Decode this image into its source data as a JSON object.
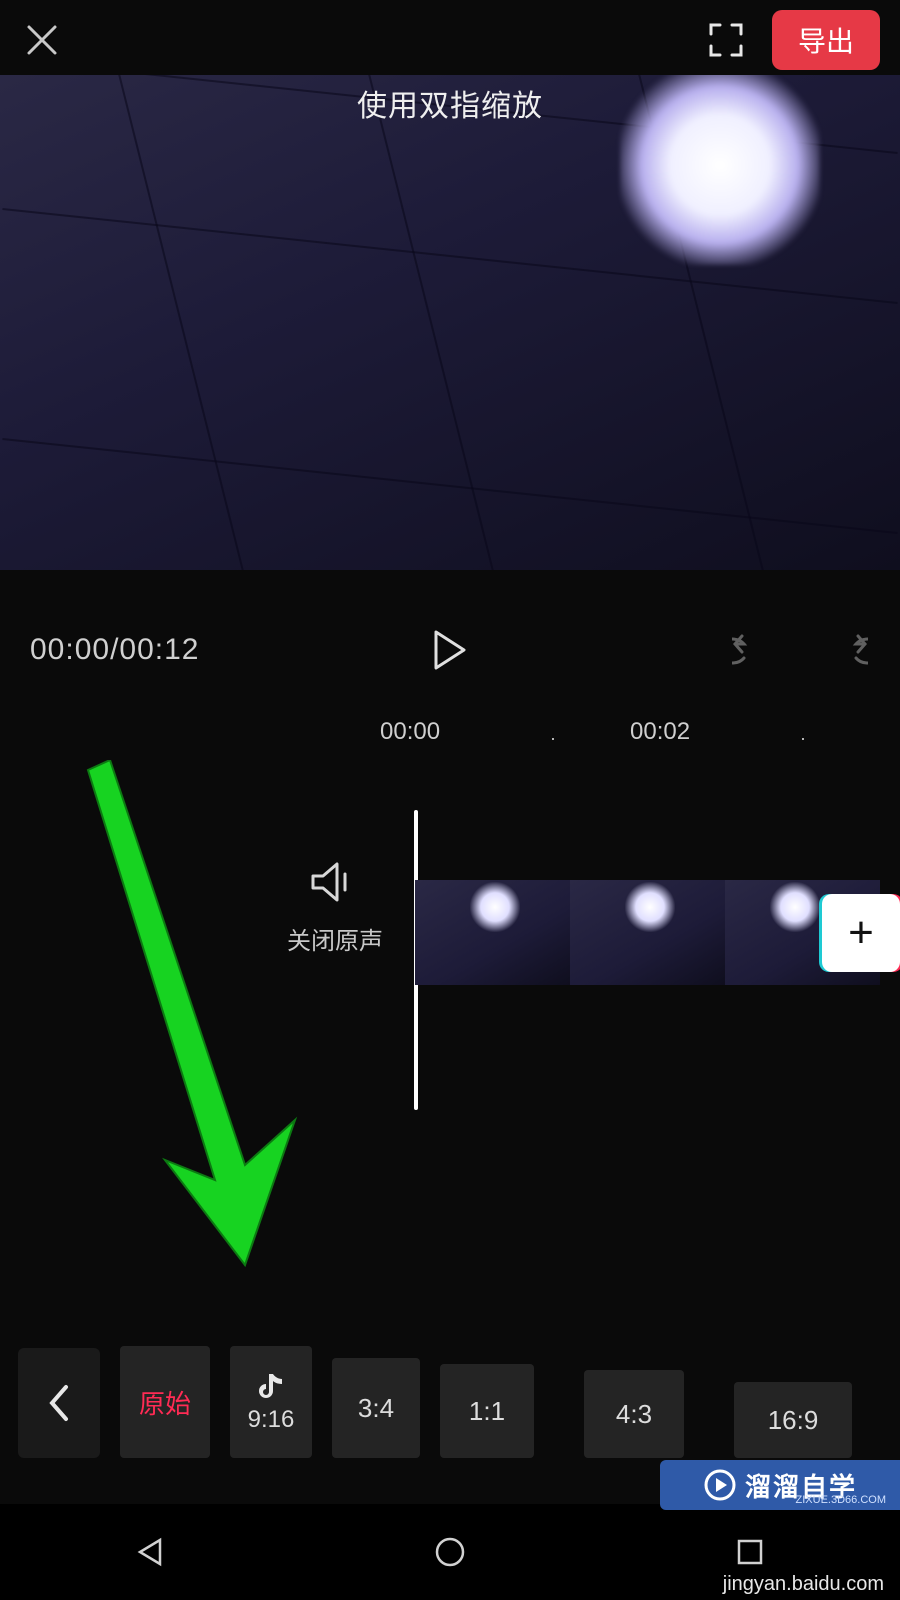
{
  "header": {
    "hint_text": "使用双指缩放",
    "export_label": "导出"
  },
  "controls": {
    "time_display": "00:00/00:12"
  },
  "ruler": {
    "tick_0": "00:00",
    "tick_2": "00:02",
    "dot": "·"
  },
  "timeline": {
    "mute_label": "关闭原声"
  },
  "ratio_bar": {
    "original": "原始",
    "r_9_16": "9:16",
    "r_3_4": "3:4",
    "r_1_1": "1:1",
    "r_4_3": "4:3",
    "r_16_9": "16:9"
  },
  "watermark": {
    "brand": "溜溜自学",
    "sub": "ZIXUE.3D66.COM",
    "credit": "jingyan.baidu.com"
  }
}
